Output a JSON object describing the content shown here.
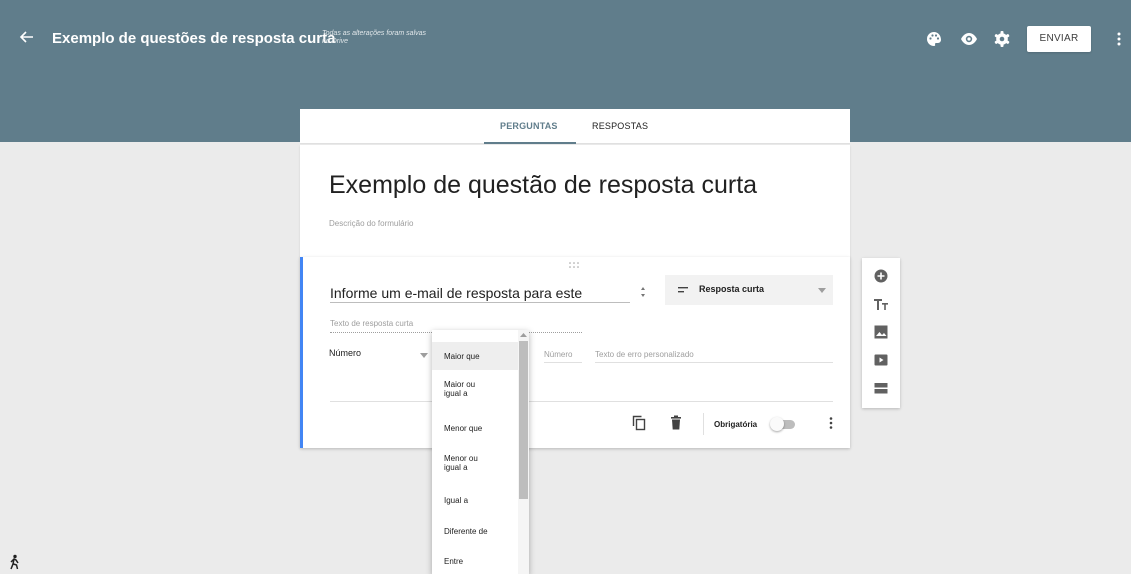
{
  "appbar": {
    "back_icon": "arrow-left-icon",
    "title": "Exemplo de questões de resposta curta",
    "save_status": "Todas as alterações foram salvas no Drive",
    "icons": [
      "palette-icon",
      "eye-icon",
      "gear-icon",
      "more-vert-icon"
    ],
    "send_label": "ENVIAR",
    "color": "#607d8b"
  },
  "tabs": [
    {
      "label": "PERGUNTAS",
      "active": true
    },
    {
      "label": "RESPOSTAS",
      "active": false
    }
  ],
  "form": {
    "title": "Exemplo de questão de resposta curta",
    "description_placeholder": "Descrição do formulário"
  },
  "question": {
    "title": "Informe um e-mail de resposta para este",
    "type": "Resposta curta",
    "answer_placeholder": "Texto de resposta curta",
    "validation_type": "Número",
    "number_placeholder": "Número",
    "error_placeholder": "Texto de erro personalizado",
    "required_label": "Obrigatória",
    "required": false,
    "accent_color": "#4285f4"
  },
  "side_toolbar": [
    "add-circle-icon",
    "text-title-icon",
    "image-icon",
    "video-icon",
    "section-icon"
  ],
  "dropdown": {
    "selected": "Maior que",
    "options": [
      "Maior que",
      "Maior ou igual a",
      "Menor que",
      "Menor ou igual a",
      "Igual a",
      "Diferente de",
      "Entre"
    ]
  }
}
